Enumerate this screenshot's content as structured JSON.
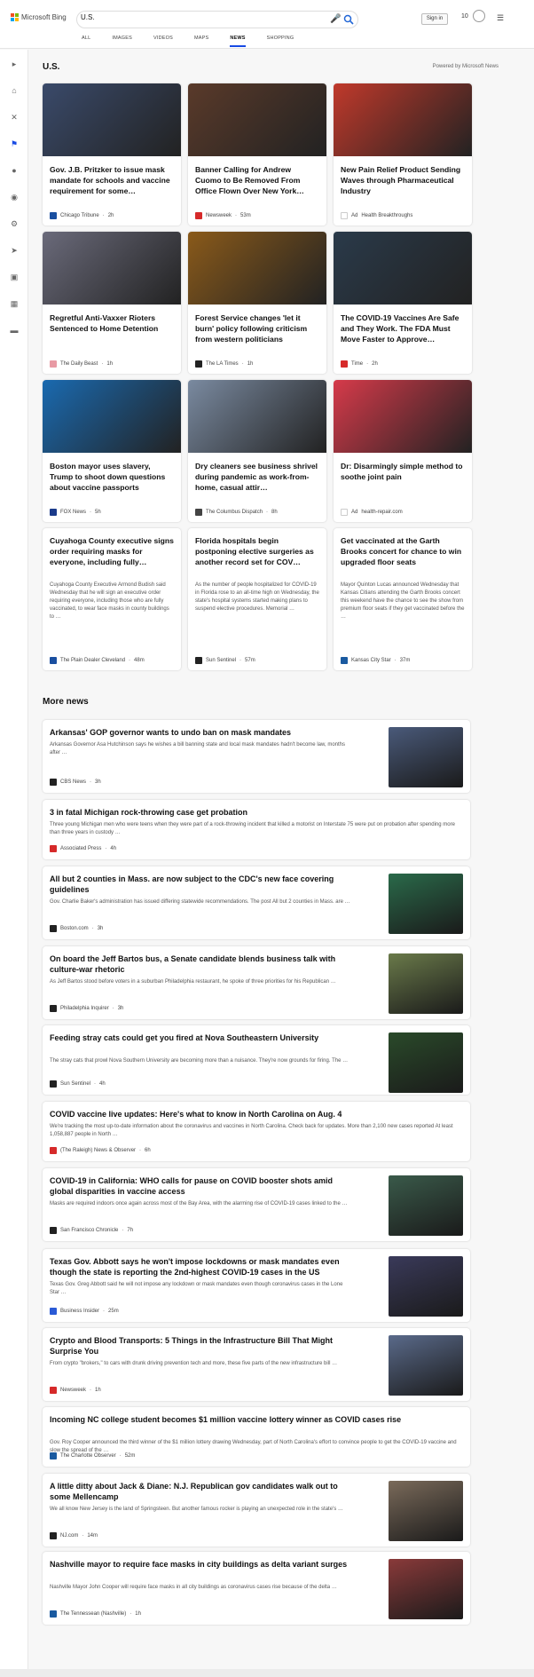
{
  "header": {
    "brand": "Microsoft Bing",
    "query": "U.S.",
    "signin": "Sign in",
    "rewards_count": "10",
    "tabs": [
      {
        "label": "ALL"
      },
      {
        "label": "IMAGES"
      },
      {
        "label": "VIDEOS"
      },
      {
        "label": "MAPS"
      },
      {
        "label": "NEWS",
        "active": true
      },
      {
        "label": "SHOPPING"
      }
    ]
  },
  "section": {
    "title": "U.S.",
    "powered": "Powered by Microsoft News"
  },
  "cards": [
    {
      "title": "Gov. J.B. Pritzker to issue mask mandate for schools and vaccine requirement for some…",
      "source": "Chicago Tribune",
      "time": "2h",
      "color": "#3a4a6a",
      "icon": "#1a4fa0"
    },
    {
      "title": "Banner Calling for Andrew Cuomo to Be Removed From Office Flown Over New York…",
      "source": "Newsweek",
      "time": "53m",
      "color": "#5a3a2a",
      "icon": "#d62a2a"
    },
    {
      "title": "New Pain Relief Product Sending Waves through Pharmaceutical Industry",
      "source": "Health Breakthroughs",
      "time": "",
      "ad": "Ad",
      "color": "#c0392b",
      "icon": "#ffffff"
    },
    {
      "title": "Regretful Anti-Vaxxer Rioters Sentenced to Home Detention",
      "source": "The Daily Beast",
      "time": "1h",
      "color": "#6a6a7a",
      "icon": "#e89aa4"
    },
    {
      "title": "Forest Service changes 'let it burn' policy following criticism from western politicians",
      "source": "The LA Times",
      "time": "1h",
      "color": "#8a5a1a",
      "icon": "#222222"
    },
    {
      "title": "The COVID-19 Vaccines Are Safe and They Work. The FDA Must Move Faster to Approve…",
      "source": "Time",
      "time": "2h",
      "color": "#2a3a4a",
      "icon": "#d62a2a"
    },
    {
      "title": "Boston mayor uses slavery, Trump to shoot down questions about vaccine passports",
      "source": "FOX News",
      "time": "5h",
      "color": "#1a6ab0",
      "icon": "#1a3a8a"
    },
    {
      "title": "Dry cleaners see business shrivel during pandemic as work-from-home, casual attir…",
      "source": "The Columbus Dispatch",
      "time": "8h",
      "color": "#7a8aa0",
      "icon": "#444444"
    },
    {
      "title": "Dr: Disarmingly simple method to soothe joint pain",
      "source": "health-repair.com",
      "time": "",
      "ad": "Ad",
      "color": "#d63a4a",
      "icon": "#ffffff"
    }
  ],
  "long_cards": [
    {
      "title": "Cuyahoga County executive signs order requiring masks for everyone, including fully…",
      "desc": "Cuyahoga County Executive Armond Budish said Wednesday that he will sign an executive order requiring everyone, including those who are fully vaccinated, to wear face masks in county buildings to …",
      "source": "The Plain Dealer Cleveland",
      "time": "48m",
      "icon": "#1a4fa0"
    },
    {
      "title": "Florida hospitals begin postponing elective surgeries as another record set for COV…",
      "desc": "As the number of people hospitalized for COVID-19 in Florida rose to an all-time high on Wednesday, the state's hospital systems started making plans to suspend elective procedures. Memorial …",
      "source": "Sun Sentinel",
      "time": "57m",
      "icon": "#222222"
    },
    {
      "title": "Get vaccinated at the Garth Brooks concert for chance to win upgraded floor seats",
      "desc": "Mayor Quinton Lucas announced Wednesday that Kansas Citians attending the Garth Brooks concert this weekend have the chance to see the show from premium floor seats if they get vaccinated before the …",
      "source": "Kansas City Star",
      "time": "37m",
      "icon": "#1a5aa0"
    }
  ],
  "more_title": "More news",
  "more": [
    {
      "title": "Arkansas' GOP governor wants to undo ban on mask mandates",
      "desc": "Arkansas Governor Asa Hutchinson says he wishes a bill banning state and local mask mandates hadn't become law, months after …",
      "source": "CBS News",
      "time": "3h",
      "thumb": "#4a5a7a",
      "icon": "#222222"
    },
    {
      "title": "3 in fatal Michigan rock-throwing case get probation",
      "desc": "Three young Michigan men who were teens when they were part of a rock-throwing incident that killed a motorist on Interstate 75 were put on probation after spending more than three years in custody …",
      "source": "Associated Press",
      "time": "4h",
      "icon": "#d62a2a"
    },
    {
      "title": "All but 2 counties in Mass. are now subject to the CDC's new face covering guidelines",
      "desc": "Gov. Charlie Baker's administration has issued differing statewide recommendations. The post All but 2 counties in Mass. are …",
      "source": "Boston.com",
      "time": "3h",
      "thumb": "#2a6a4a",
      "icon": "#222222"
    },
    {
      "title": "On board the Jeff Bartos bus, a Senate candidate blends business talk with culture-war rhetoric",
      "desc": "As Jeff Bartos stood before voters in a suburban Philadelphia restaurant, he spoke of three priorities for his Republican …",
      "source": "Philadelphia Inquirer",
      "time": "3h",
      "thumb": "#6a7a4a",
      "icon": "#222222"
    },
    {
      "title": "Feeding stray cats could get you fired at Nova Southeastern University",
      "desc": "The stray cats that prowl Nova Southern University are becoming more than a nuisance. They're now grounds for firing. The …",
      "source": "Sun Sentinel",
      "time": "4h",
      "thumb": "#2a4a2a",
      "icon": "#222222"
    },
    {
      "title": "COVID vaccine live updates: Here's what to know in North Carolina on Aug. 4",
      "desc": "We're tracking the most up-to-date information about the coronavirus and vaccines in North Carolina. Check back for updates. More than 2,100 new cases reported At least 1,058,887 people in North …",
      "source": "(The Raleigh) News & Observer",
      "time": "6h",
      "icon": "#d62a2a"
    },
    {
      "title": "COVID-19 in California: WHO calls for pause on COVID booster shots amid global disparities in vaccine access",
      "desc": "Masks are required indoors once again across most of the Bay Area, with the alarming rise of COVID-19 cases linked to the …",
      "source": "San Francisco Chronicle",
      "time": "7h",
      "thumb": "#3a5a4a",
      "icon": "#222222"
    },
    {
      "title": "Texas Gov. Abbott says he won't impose lockdowns or mask mandates even though the state is reporting the 2nd-highest COVID-19 cases in the US",
      "desc": "Texas Gov. Greg Abbott said he will not impose any lockdown or mask mandates even though coronavirus cases in the Lone Star …",
      "source": "Business Insider",
      "time": "25m",
      "thumb": "#3a3a5a",
      "icon": "#2a5ad6"
    },
    {
      "title": "Crypto and Blood Transports: 5 Things in the Infrastructure Bill That Might Surprise You",
      "desc": "From crypto \"brokers,\" to cars with drunk driving prevention tech and more, these five parts of the new infrastructure bill …",
      "source": "Newsweek",
      "time": "1h",
      "thumb": "#5a6a8a",
      "icon": "#d62a2a"
    },
    {
      "title": "Incoming NC college student becomes $1 million vaccine lottery winner as COVID cases rise",
      "desc": "Gov. Roy Cooper announced the third winner of the $1 million lottery drawing Wednesday, part of North Carolina's effort to convince people to get the COVID-19 vaccine and slow the spread of the …",
      "source": "The Charlotte Observer",
      "time": "52m",
      "icon": "#1a5aa0"
    },
    {
      "title": "A little ditty about Jack & Diane: N.J. Republican gov candidates walk out to some Mellencamp",
      "desc": "We all know New Jersey is the land of Springsteen. But another famous rocker is playing an unexpected role in the state's …",
      "source": "NJ.com",
      "time": "14m",
      "thumb": "#7a6a5a",
      "icon": "#222222"
    },
    {
      "title": "Nashville mayor to require face masks in city buildings as delta variant surges",
      "desc": "Nashville Mayor John Cooper will require face masks in all city buildings as coronavirus cases rise because of the delta …",
      "source": "The Tennessean (Nashville)",
      "time": "1h",
      "thumb": "#8a3a3a",
      "icon": "#1a5aa0"
    }
  ]
}
